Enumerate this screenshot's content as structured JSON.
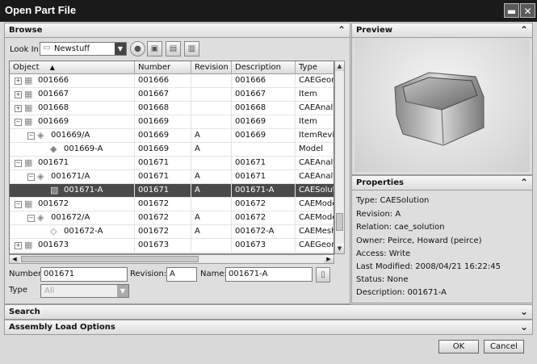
{
  "window": {
    "title": "Open Part File",
    "minimize_glyph": "▬",
    "close_glyph": "✕"
  },
  "browse": {
    "header": "Browse",
    "lookin_label": "Look In",
    "lookin_value": "Newstuff",
    "toolbar_icons": [
      "back-icon",
      "new-folder-icon",
      "up-folder-icon",
      "view-icon"
    ],
    "columns": [
      "Object",
      "Number",
      "Revision",
      "Description",
      "Type"
    ],
    "sort_glyph": "▲",
    "rows": [
      {
        "object": "001666",
        "number": "001666",
        "revision": "",
        "description": "001666",
        "type": "CAEGeom"
      },
      {
        "object": "001667",
        "number": "001667",
        "revision": "",
        "description": "001667",
        "type": "Item"
      },
      {
        "object": "001668",
        "number": "001668",
        "revision": "",
        "description": "001668",
        "type": "CAEAnaly"
      },
      {
        "object": "001669",
        "number": "001669",
        "revision": "",
        "description": "001669",
        "type": "Item"
      },
      {
        "object": "001669/A",
        "number": "001669",
        "revision": "A",
        "description": "001669",
        "type": "ItemRevis"
      },
      {
        "object": "001669-A",
        "number": "001669",
        "revision": "A",
        "description": "",
        "type": "Model"
      },
      {
        "object": "001671",
        "number": "001671",
        "revision": "",
        "description": "001671",
        "type": "CAEAnaly"
      },
      {
        "object": "001671/A",
        "number": "001671",
        "revision": "A",
        "description": "001671",
        "type": "CAEAnaly"
      },
      {
        "object": "001671-A",
        "number": "001671",
        "revision": "A",
        "description": "001671-A",
        "type": "CAESoluti"
      },
      {
        "object": "001672",
        "number": "001672",
        "revision": "",
        "description": "001672",
        "type": "CAEMode"
      },
      {
        "object": "001672/A",
        "number": "001672",
        "revision": "A",
        "description": "001672",
        "type": "CAEMode"
      },
      {
        "object": "001672-A",
        "number": "001672",
        "revision": "A",
        "description": "001672-A",
        "type": "CAEMesh"
      },
      {
        "object": "001673",
        "number": "001673",
        "revision": "",
        "description": "001673",
        "type": "CAEGeom"
      }
    ],
    "number_label": "Number:",
    "number_value": "001671",
    "revision_label": "Revision:",
    "revision_value": "A",
    "name_label": "Name:",
    "name_value": "001671-A",
    "type_label": "Type",
    "type_value": "All"
  },
  "preview": {
    "header": "Preview"
  },
  "properties": {
    "header": "Properties",
    "lines": [
      "Type: CAESolution",
      "Revision: A",
      "Relation: cae_solution",
      "Owner: Peirce, Howard (peirce)",
      "Access: Write",
      "Last Modified: 2008/04/21 16:22:45",
      "Status: None",
      "Description: 001671-A"
    ]
  },
  "search": {
    "header": "Search"
  },
  "assembly": {
    "header": "Assembly Load Options"
  },
  "buttons": {
    "ok": "OK",
    "cancel": "Cancel"
  },
  "chevrons": {
    "up": "⌃",
    "down": "⌄"
  }
}
